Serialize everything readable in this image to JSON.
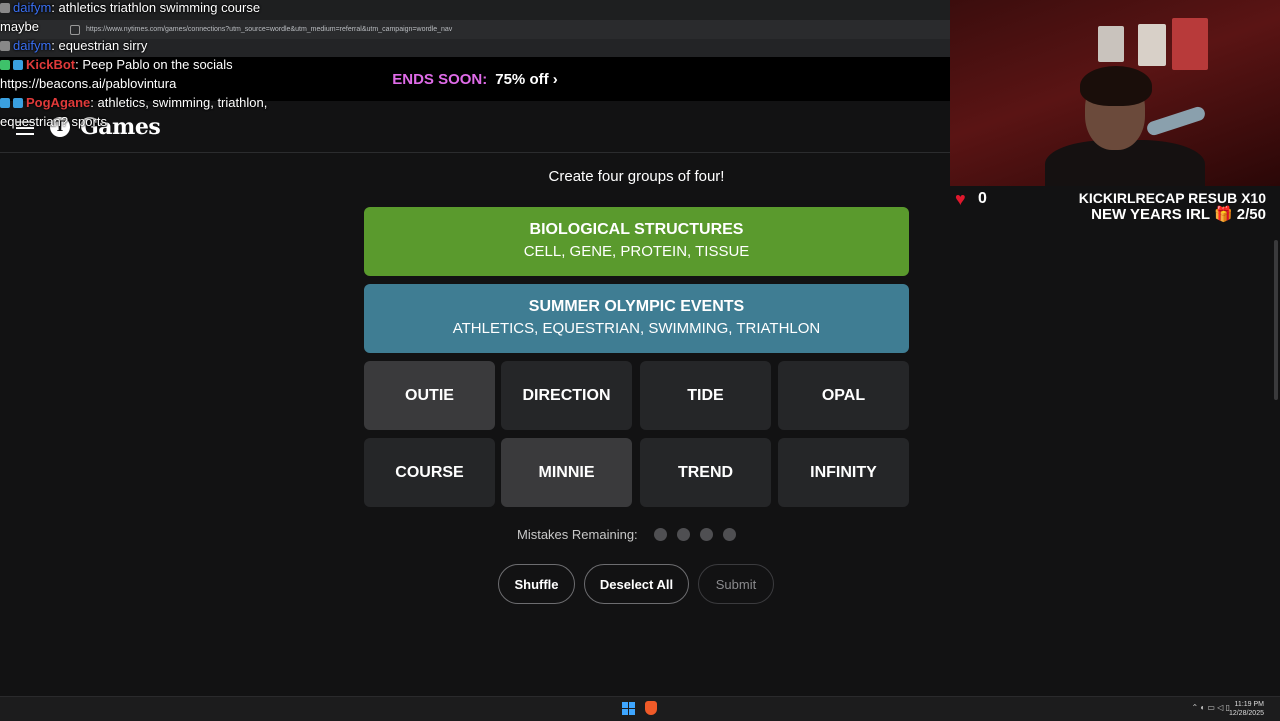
{
  "browser": {
    "url": "https://www.nytimes.com/games/connections?utm_source=wordle&utm_medium=referral&utm_campaign=wordle_nav"
  },
  "promo": {
    "ends": "ENDS SOON:",
    "offer": "75% off ›"
  },
  "header": {
    "logo_letter": "T",
    "games": "Games"
  },
  "chat": [
    {
      "user": "daifym",
      "text": ": athletics triathlon swimming course"
    },
    {
      "user": "",
      "text": "maybe"
    },
    {
      "user": "daifym",
      "text": ": equestrian sirry"
    },
    {
      "user": "KickBot",
      "text": ": Peep Pablo on the socials"
    },
    {
      "user": "",
      "text": "https://beacons.ai/pablovintura"
    },
    {
      "user": "PogAgane",
      "text": ": athletics, swimming, triathlon,"
    },
    {
      "user": "",
      "text": "equestrian? sports"
    }
  ],
  "game": {
    "subtitle": "Create four groups of four!",
    "solved": [
      {
        "category": "BIOLOGICAL STRUCTURES",
        "words": "CELL, GENE, PROTEIN, TISSUE",
        "color": "#5a9a2d"
      },
      {
        "category": "SUMMER OLYMPIC EVENTS",
        "words": "ATHLETICS, EQUESTRIAN, SWIMMING, TRIATHLON",
        "color": "#3f7d93"
      }
    ],
    "tiles": [
      "OUTIE",
      "DIRECTION",
      "TIDE",
      "OPAL",
      "COURSE",
      "MINNIE",
      "TREND",
      "INFINITY"
    ],
    "mistakes_label": "Mistakes Remaining:",
    "mistakes_remaining": 4,
    "buttons": {
      "shuffle": "Shuffle",
      "deselect": "Deselect All",
      "submit": "Submit"
    }
  },
  "stream": {
    "heart_count": "0",
    "resub": "KICKIRLRECAP RESUB X10",
    "goal": "NEW YEARS IRL 🎁 2/50"
  },
  "taskbar": {
    "time": "11:19 PM",
    "date": "12/28/2025"
  }
}
